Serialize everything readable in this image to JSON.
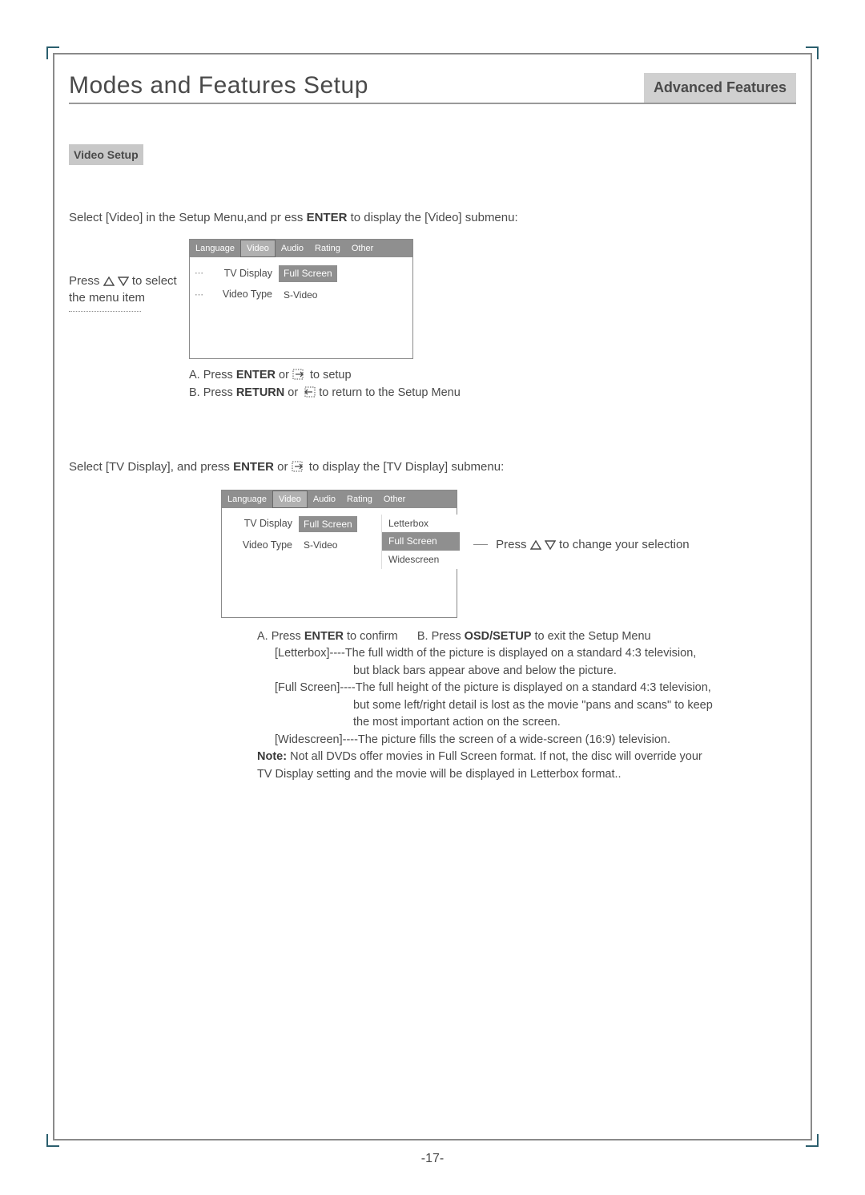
{
  "header": {
    "title": "Modes and Features Setup",
    "breadcrumb": "Advanced Features"
  },
  "section": {
    "title": "Video Setup"
  },
  "intro1_pre": "Select [Video] in the Setup Menu,and pr ess ",
  "intro1_bold": "ENTER",
  "intro1_post": " to display the [Video] submenu:",
  "hint_left_pre": "Press ",
  "hint_left_post": " to select the menu item",
  "tabs": [
    "Language",
    "Video",
    "Audio",
    "Rating",
    "Other"
  ],
  "menu1": {
    "row1_label": "TV Display",
    "row1_value": "Full Screen",
    "row2_label": "Video Type",
    "row2_value": "S-Video"
  },
  "under1": {
    "a_pre": "A.  Press ",
    "a_bold": "ENTER",
    "a_mid": " or",
    "a_post": "to setup",
    "b_pre": "B.  Press ",
    "b_bold": "RETURN",
    "b_mid": " or ",
    "b_post": "to return to the Setup Menu"
  },
  "intro2_pre": "Select [TV Display], and press ",
  "intro2_bold": "ENTER",
  "intro2_mid": " or",
  "intro2_post": " to display the [TV Display] submenu:",
  "submenu": {
    "opts": [
      "Letterbox",
      "Full Screen",
      "Widescreen"
    ]
  },
  "hint_right_pre": "Press ",
  "hint_right_post": " to change your selection",
  "desc": {
    "a_pre": "A.  Press ",
    "a_bold": "ENTER",
    "a_post": " to confirm",
    "b_pre": "B.  Press ",
    "b_bold": "OSD/SETUP",
    "b_post": " to exit the Setup Menu",
    "letterbox_l1": "[Letterbox]----The full width of the picture is displayed on a standard 4:3 television,",
    "letterbox_l2": "but black bars appear above and below the picture.",
    "fullscreen_l1": "[Full Screen]----The full height of the picture is displayed on a standard 4:3 television,",
    "fullscreen_l2": "but some left/right detail is lost as the movie \"pans and scans\" to keep",
    "fullscreen_l3": "the most important action on the screen.",
    "widescreen": "[Widescreen]----The picture fills the screen of a wide-screen (16:9) television.",
    "note_bold": "Note:",
    "note_l1": " Not all DVDs offer movies in Full Screen  format. If not, the disc will override your",
    "note_l2": "TV Display setting and the movie will be displayed in Letterbox format.."
  },
  "page_number": "-17-"
}
